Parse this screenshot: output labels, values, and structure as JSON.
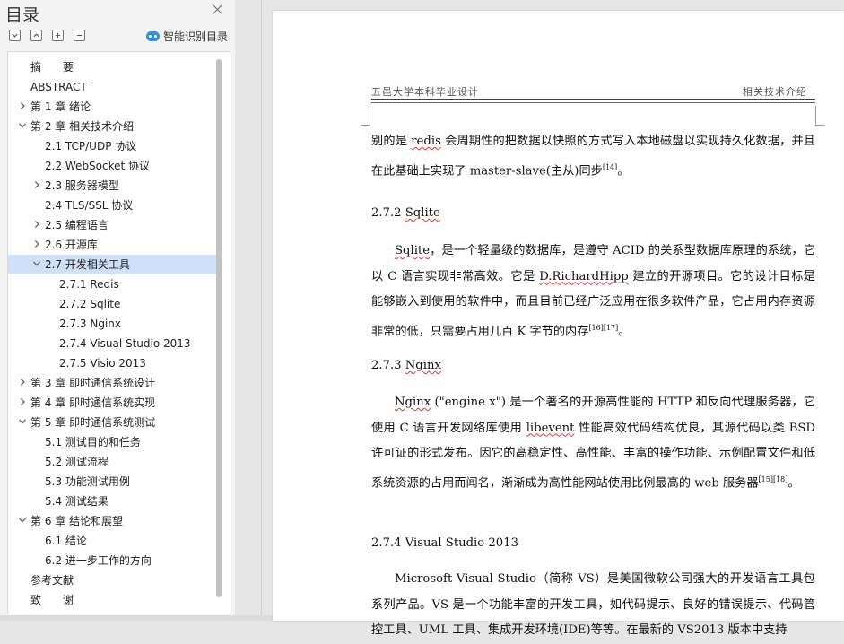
{
  "sidebar": {
    "title": "目录",
    "smart_label": "智能识别目录",
    "items": [
      {
        "label": "摘　　要",
        "level": 0,
        "chevron": "none"
      },
      {
        "label": "ABSTRACT",
        "level": 0,
        "chevron": "none"
      },
      {
        "label": "第 1 章  绪论",
        "level": 0,
        "chevron": "right"
      },
      {
        "label": "第 2 章  相关技术介绍",
        "level": 0,
        "chevron": "down"
      },
      {
        "label": "2.1 TCP/UDP 协议",
        "level": 1,
        "chevron": "none"
      },
      {
        "label": "2.2 WebSocket 协议",
        "level": 1,
        "chevron": "none"
      },
      {
        "label": "2.3  服务器模型",
        "level": 1,
        "chevron": "right"
      },
      {
        "label": "2.4 TLS/SSL 协议",
        "level": 1,
        "chevron": "none"
      },
      {
        "label": "2.5 编程语言",
        "level": 1,
        "chevron": "right"
      },
      {
        "label": "2.6  开源库",
        "level": 1,
        "chevron": "right"
      },
      {
        "label": "2.7  开发相关工具",
        "level": 1,
        "chevron": "down",
        "active": true
      },
      {
        "label": "2.7.1 Redis",
        "level": 2,
        "chevron": "none"
      },
      {
        "label": "2.7.2 Sqlite",
        "level": 2,
        "chevron": "none"
      },
      {
        "label": "2.7.3 Nginx",
        "level": 2,
        "chevron": "none"
      },
      {
        "label": "2.7.4 Visual Studio 2013",
        "level": 2,
        "chevron": "none"
      },
      {
        "label": "2.7.5 Visio 2013",
        "level": 2,
        "chevron": "none"
      },
      {
        "label": "第 3 章  即时通信系统设计",
        "level": 0,
        "chevron": "right"
      },
      {
        "label": "第 4 章  即时通信系统实现",
        "level": 0,
        "chevron": "right"
      },
      {
        "label": "第 5 章  即时通信系统测试",
        "level": 0,
        "chevron": "down"
      },
      {
        "label": "5.1 测试目的和任务",
        "level": 1,
        "chevron": "none"
      },
      {
        "label": "5.2 测试流程",
        "level": 1,
        "chevron": "none"
      },
      {
        "label": "5.3  功能测试用例",
        "level": 1,
        "chevron": "none"
      },
      {
        "label": "5.4  测试结果",
        "level": 1,
        "chevron": "none"
      },
      {
        "label": "第 6 章  结论和展望",
        "level": 0,
        "chevron": "down"
      },
      {
        "label": "6.1  结论",
        "level": 1,
        "chevron": "none"
      },
      {
        "label": "6.2  进一步工作的方向",
        "level": 1,
        "chevron": "none"
      },
      {
        "label": "参考文献",
        "level": 0,
        "chevron": "none"
      },
      {
        "label": "致　　谢",
        "level": 0,
        "chevron": "none"
      }
    ]
  },
  "document": {
    "header_left": "五邑大学本科毕业设计",
    "header_right": "相关技术介绍",
    "p1": {
      "a": "别的是 ",
      "b": "redis",
      "c": " 会周期性的把数据以快照的方式写入本地磁盘以实现持久化数据，并且在此基础上实现了 master-slave(主从)同步",
      "ref": "[14]",
      "d": "。"
    },
    "s272": {
      "num": "2.7.2 ",
      "name": "Sqlite"
    },
    "p2": {
      "a": "Sqlite",
      "b": "，是一个轻量级的数据库，是遵守 ACID 的关系型数据库原理的系统，它以 C 语言实现非常高效。它是 ",
      "c": "D.RichardHipp",
      "d": " 建立的开源项目。它的设计目标是能够嵌入到使用的软件中，而且目前已经广泛应用在很多软件产品，它占用内存资源非常的低，只需要占用几百 K 字节的内存",
      "ref": "[16][17]",
      "e": "。"
    },
    "s273": {
      "num": "2.7.3 ",
      "name": "Nginx"
    },
    "p3": {
      "a": "Nginx",
      "b": " (\"engine x\") 是一个著名的开源高性能的  HTTP  和反向代理服务器，它使用 C 语言开发网络库使用 ",
      "c": "libevent",
      "d": " 性能高效代码结构优良，其源代码以类 BSD 许可证的形式发布。因它的高稳定性、高性能、丰富的操作功能、示例配置文件和低系统资源的占用而闻名，渐渐成为高性能网站使用比例最高的 web 服务器",
      "ref": "[15][18]",
      "e": "。"
    },
    "s274": "2.7.4 Visual Studio 2013",
    "p4": "Microsoft Visual Studio（简称 VS）是美国微软公司强大的开发语言工具包系列产品。VS 是一个功能丰富的开发工具，如代码提示、良好的错误提示、代码管控工具、UML 工具、集成开发环境(IDE)等等。在最新的 VS2013 版本中支持"
  }
}
